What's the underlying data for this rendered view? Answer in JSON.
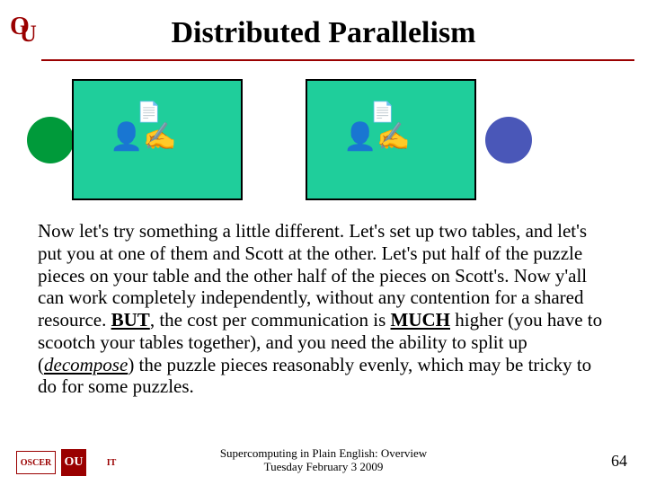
{
  "title": "Distributed Parallelism",
  "body": {
    "p1a": "Now let's try something a little different. Let's set up two tables, and let's put you at one of them and Scott at the other. Let's put half of the puzzle pieces on your table and the other half of the pieces on Scott's. Now y'all can work completely independently, without any contention for a shared resource. ",
    "but": "BUT",
    "p1b": ", the cost per communication is ",
    "much": "MUCH",
    "p1c": " higher (you have to scootch your tables together), and you need the ability to split up (",
    "decompose": "decompose",
    "p1d": ") the puzzle pieces reasonably evenly, which may be tricky to do for some puzzles."
  },
  "footer": {
    "line1": "Supercomputing in Plain English: Overview",
    "line2": "Tuesday February 3 2009"
  },
  "page": "64",
  "logos": {
    "ou": "OU",
    "oscer": "OSCER",
    "it": "IT"
  }
}
